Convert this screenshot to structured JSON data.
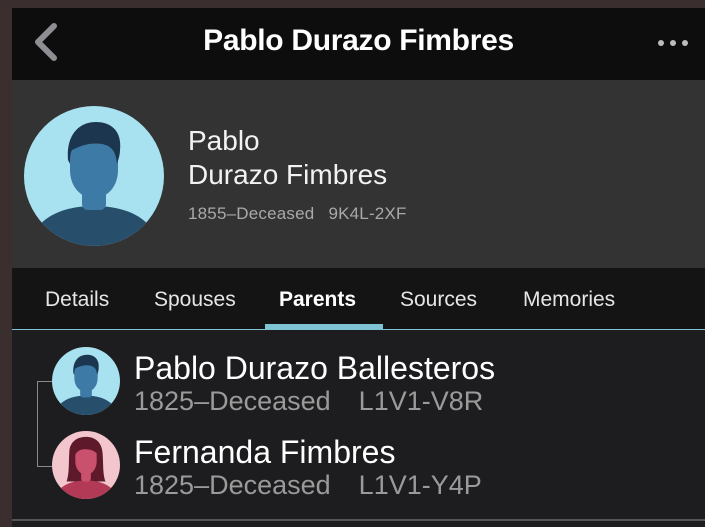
{
  "nav": {
    "title": "Pablo Durazo Fimbres",
    "back_icon": "chevron-left-icon",
    "more_icon": "more-horizontal-icon"
  },
  "person": {
    "first_name": "Pablo",
    "last_name": "Durazo Fimbres",
    "lifespan": "1855–Deceased",
    "id": "9K4L-2XF",
    "avatar_icon": "male-avatar-icon"
  },
  "tabs": [
    {
      "label": "Details",
      "active": false
    },
    {
      "label": "Spouses",
      "active": false
    },
    {
      "label": "Parents",
      "active": true
    },
    {
      "label": "Sources",
      "active": false
    },
    {
      "label": "Memories",
      "active": false
    }
  ],
  "parents": [
    {
      "name": "Pablo Durazo Ballesteros",
      "lifespan": "1825–Deceased",
      "id": "L1V1-V8R",
      "avatar_icon": "male-avatar-icon"
    },
    {
      "name": "Fernanda Fimbres",
      "lifespan": "1825–Deceased",
      "id": "L1V1-Y4P",
      "avatar_icon": "female-avatar-icon"
    }
  ],
  "colors": {
    "accent": "#7fc4d4",
    "male_avatar_bg": "#a8e1f0",
    "female_avatar_bg": "#f3c5cc"
  }
}
